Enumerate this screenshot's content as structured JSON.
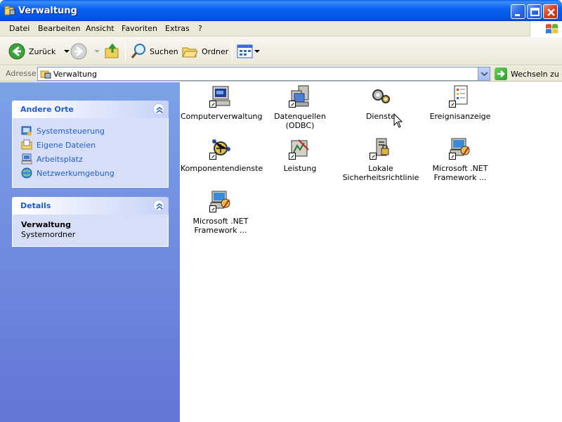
{
  "window": {
    "title": "Verwaltung"
  },
  "menu": [
    "Datei",
    "Bearbeiten",
    "Ansicht",
    "Favoriten",
    "Extras",
    "?"
  ],
  "toolbar": {
    "back_label": "Zurück",
    "search_label": "Suchen",
    "folders_label": "Ordner"
  },
  "address": {
    "label": "Adresse",
    "value": "Verwaltung",
    "go_label": "Wechseln zu"
  },
  "other_places": {
    "title": "Andere Orte",
    "links": [
      "Systemsteuerung",
      "Eigene Dateien",
      "Arbeitsplatz",
      "Netzwerkumgebung"
    ]
  },
  "details": {
    "title": "Details",
    "name": "Verwaltung",
    "type": "Systemordner"
  },
  "items": [
    {
      "label": "Computerverwaltung",
      "icon": "computer-management-icon"
    },
    {
      "label": "Datenquellen (ODBC)",
      "icon": "odbc-icon"
    },
    {
      "label": "Dienste",
      "icon": "services-icon"
    },
    {
      "label": "Ereignisanzeige",
      "icon": "event-viewer-icon"
    },
    {
      "label": "Komponentendienste",
      "icon": "component-services-icon"
    },
    {
      "label": "Leistung",
      "icon": "performance-icon"
    },
    {
      "label": "Lokale Sicherheitsrichtlinie",
      "icon": "security-policy-icon"
    },
    {
      "label": "Microsoft .NET Framework ...",
      "icon": "dotnet-config-icon"
    },
    {
      "label": "Microsoft .NET Framework ...",
      "icon": "dotnet-wizards-icon"
    }
  ]
}
